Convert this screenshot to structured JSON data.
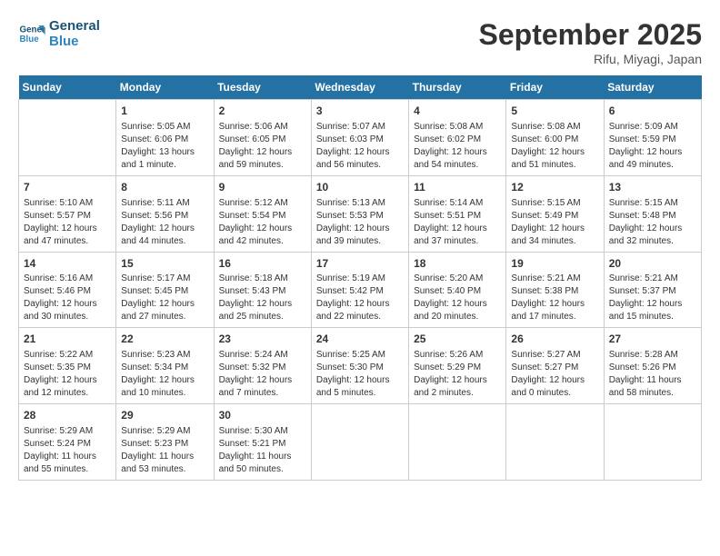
{
  "header": {
    "logo_line1": "General",
    "logo_line2": "Blue",
    "month": "September 2025",
    "location": "Rifu, Miyagi, Japan"
  },
  "days_of_week": [
    "Sunday",
    "Monday",
    "Tuesday",
    "Wednesday",
    "Thursday",
    "Friday",
    "Saturday"
  ],
  "weeks": [
    [
      {
        "num": "",
        "info": ""
      },
      {
        "num": "1",
        "info": "Sunrise: 5:05 AM\nSunset: 6:06 PM\nDaylight: 13 hours\nand 1 minute."
      },
      {
        "num": "2",
        "info": "Sunrise: 5:06 AM\nSunset: 6:05 PM\nDaylight: 12 hours\nand 59 minutes."
      },
      {
        "num": "3",
        "info": "Sunrise: 5:07 AM\nSunset: 6:03 PM\nDaylight: 12 hours\nand 56 minutes."
      },
      {
        "num": "4",
        "info": "Sunrise: 5:08 AM\nSunset: 6:02 PM\nDaylight: 12 hours\nand 54 minutes."
      },
      {
        "num": "5",
        "info": "Sunrise: 5:08 AM\nSunset: 6:00 PM\nDaylight: 12 hours\nand 51 minutes."
      },
      {
        "num": "6",
        "info": "Sunrise: 5:09 AM\nSunset: 5:59 PM\nDaylight: 12 hours\nand 49 minutes."
      }
    ],
    [
      {
        "num": "7",
        "info": "Sunrise: 5:10 AM\nSunset: 5:57 PM\nDaylight: 12 hours\nand 47 minutes."
      },
      {
        "num": "8",
        "info": "Sunrise: 5:11 AM\nSunset: 5:56 PM\nDaylight: 12 hours\nand 44 minutes."
      },
      {
        "num": "9",
        "info": "Sunrise: 5:12 AM\nSunset: 5:54 PM\nDaylight: 12 hours\nand 42 minutes."
      },
      {
        "num": "10",
        "info": "Sunrise: 5:13 AM\nSunset: 5:53 PM\nDaylight: 12 hours\nand 39 minutes."
      },
      {
        "num": "11",
        "info": "Sunrise: 5:14 AM\nSunset: 5:51 PM\nDaylight: 12 hours\nand 37 minutes."
      },
      {
        "num": "12",
        "info": "Sunrise: 5:15 AM\nSunset: 5:49 PM\nDaylight: 12 hours\nand 34 minutes."
      },
      {
        "num": "13",
        "info": "Sunrise: 5:15 AM\nSunset: 5:48 PM\nDaylight: 12 hours\nand 32 minutes."
      }
    ],
    [
      {
        "num": "14",
        "info": "Sunrise: 5:16 AM\nSunset: 5:46 PM\nDaylight: 12 hours\nand 30 minutes."
      },
      {
        "num": "15",
        "info": "Sunrise: 5:17 AM\nSunset: 5:45 PM\nDaylight: 12 hours\nand 27 minutes."
      },
      {
        "num": "16",
        "info": "Sunrise: 5:18 AM\nSunset: 5:43 PM\nDaylight: 12 hours\nand 25 minutes."
      },
      {
        "num": "17",
        "info": "Sunrise: 5:19 AM\nSunset: 5:42 PM\nDaylight: 12 hours\nand 22 minutes."
      },
      {
        "num": "18",
        "info": "Sunrise: 5:20 AM\nSunset: 5:40 PM\nDaylight: 12 hours\nand 20 minutes."
      },
      {
        "num": "19",
        "info": "Sunrise: 5:21 AM\nSunset: 5:38 PM\nDaylight: 12 hours\nand 17 minutes."
      },
      {
        "num": "20",
        "info": "Sunrise: 5:21 AM\nSunset: 5:37 PM\nDaylight: 12 hours\nand 15 minutes."
      }
    ],
    [
      {
        "num": "21",
        "info": "Sunrise: 5:22 AM\nSunset: 5:35 PM\nDaylight: 12 hours\nand 12 minutes."
      },
      {
        "num": "22",
        "info": "Sunrise: 5:23 AM\nSunset: 5:34 PM\nDaylight: 12 hours\nand 10 minutes."
      },
      {
        "num": "23",
        "info": "Sunrise: 5:24 AM\nSunset: 5:32 PM\nDaylight: 12 hours\nand 7 minutes."
      },
      {
        "num": "24",
        "info": "Sunrise: 5:25 AM\nSunset: 5:30 PM\nDaylight: 12 hours\nand 5 minutes."
      },
      {
        "num": "25",
        "info": "Sunrise: 5:26 AM\nSunset: 5:29 PM\nDaylight: 12 hours\nand 2 minutes."
      },
      {
        "num": "26",
        "info": "Sunrise: 5:27 AM\nSunset: 5:27 PM\nDaylight: 12 hours\nand 0 minutes."
      },
      {
        "num": "27",
        "info": "Sunrise: 5:28 AM\nSunset: 5:26 PM\nDaylight: 11 hours\nand 58 minutes."
      }
    ],
    [
      {
        "num": "28",
        "info": "Sunrise: 5:29 AM\nSunset: 5:24 PM\nDaylight: 11 hours\nand 55 minutes."
      },
      {
        "num": "29",
        "info": "Sunrise: 5:29 AM\nSunset: 5:23 PM\nDaylight: 11 hours\nand 53 minutes."
      },
      {
        "num": "30",
        "info": "Sunrise: 5:30 AM\nSunset: 5:21 PM\nDaylight: 11 hours\nand 50 minutes."
      },
      {
        "num": "",
        "info": ""
      },
      {
        "num": "",
        "info": ""
      },
      {
        "num": "",
        "info": ""
      },
      {
        "num": "",
        "info": ""
      }
    ]
  ]
}
